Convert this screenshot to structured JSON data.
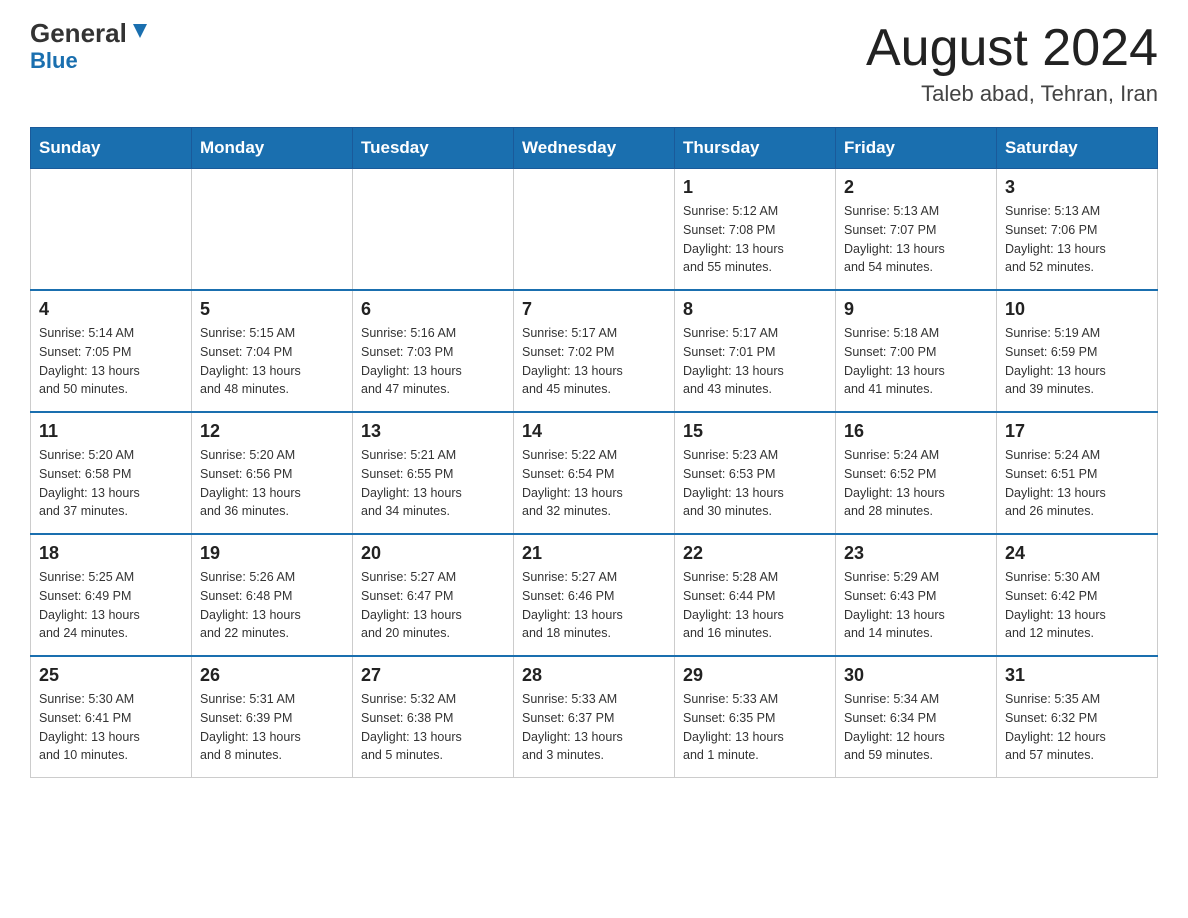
{
  "header": {
    "logo_general": "General",
    "logo_blue": "Blue",
    "title": "August 2024",
    "subtitle": "Taleb abad, Tehran, Iran"
  },
  "days_of_week": [
    "Sunday",
    "Monday",
    "Tuesday",
    "Wednesday",
    "Thursday",
    "Friday",
    "Saturday"
  ],
  "weeks": [
    [
      {
        "day": "",
        "info": ""
      },
      {
        "day": "",
        "info": ""
      },
      {
        "day": "",
        "info": ""
      },
      {
        "day": "",
        "info": ""
      },
      {
        "day": "1",
        "info": "Sunrise: 5:12 AM\nSunset: 7:08 PM\nDaylight: 13 hours\nand 55 minutes."
      },
      {
        "day": "2",
        "info": "Sunrise: 5:13 AM\nSunset: 7:07 PM\nDaylight: 13 hours\nand 54 minutes."
      },
      {
        "day": "3",
        "info": "Sunrise: 5:13 AM\nSunset: 7:06 PM\nDaylight: 13 hours\nand 52 minutes."
      }
    ],
    [
      {
        "day": "4",
        "info": "Sunrise: 5:14 AM\nSunset: 7:05 PM\nDaylight: 13 hours\nand 50 minutes."
      },
      {
        "day": "5",
        "info": "Sunrise: 5:15 AM\nSunset: 7:04 PM\nDaylight: 13 hours\nand 48 minutes."
      },
      {
        "day": "6",
        "info": "Sunrise: 5:16 AM\nSunset: 7:03 PM\nDaylight: 13 hours\nand 47 minutes."
      },
      {
        "day": "7",
        "info": "Sunrise: 5:17 AM\nSunset: 7:02 PM\nDaylight: 13 hours\nand 45 minutes."
      },
      {
        "day": "8",
        "info": "Sunrise: 5:17 AM\nSunset: 7:01 PM\nDaylight: 13 hours\nand 43 minutes."
      },
      {
        "day": "9",
        "info": "Sunrise: 5:18 AM\nSunset: 7:00 PM\nDaylight: 13 hours\nand 41 minutes."
      },
      {
        "day": "10",
        "info": "Sunrise: 5:19 AM\nSunset: 6:59 PM\nDaylight: 13 hours\nand 39 minutes."
      }
    ],
    [
      {
        "day": "11",
        "info": "Sunrise: 5:20 AM\nSunset: 6:58 PM\nDaylight: 13 hours\nand 37 minutes."
      },
      {
        "day": "12",
        "info": "Sunrise: 5:20 AM\nSunset: 6:56 PM\nDaylight: 13 hours\nand 36 minutes."
      },
      {
        "day": "13",
        "info": "Sunrise: 5:21 AM\nSunset: 6:55 PM\nDaylight: 13 hours\nand 34 minutes."
      },
      {
        "day": "14",
        "info": "Sunrise: 5:22 AM\nSunset: 6:54 PM\nDaylight: 13 hours\nand 32 minutes."
      },
      {
        "day": "15",
        "info": "Sunrise: 5:23 AM\nSunset: 6:53 PM\nDaylight: 13 hours\nand 30 minutes."
      },
      {
        "day": "16",
        "info": "Sunrise: 5:24 AM\nSunset: 6:52 PM\nDaylight: 13 hours\nand 28 minutes."
      },
      {
        "day": "17",
        "info": "Sunrise: 5:24 AM\nSunset: 6:51 PM\nDaylight: 13 hours\nand 26 minutes."
      }
    ],
    [
      {
        "day": "18",
        "info": "Sunrise: 5:25 AM\nSunset: 6:49 PM\nDaylight: 13 hours\nand 24 minutes."
      },
      {
        "day": "19",
        "info": "Sunrise: 5:26 AM\nSunset: 6:48 PM\nDaylight: 13 hours\nand 22 minutes."
      },
      {
        "day": "20",
        "info": "Sunrise: 5:27 AM\nSunset: 6:47 PM\nDaylight: 13 hours\nand 20 minutes."
      },
      {
        "day": "21",
        "info": "Sunrise: 5:27 AM\nSunset: 6:46 PM\nDaylight: 13 hours\nand 18 minutes."
      },
      {
        "day": "22",
        "info": "Sunrise: 5:28 AM\nSunset: 6:44 PM\nDaylight: 13 hours\nand 16 minutes."
      },
      {
        "day": "23",
        "info": "Sunrise: 5:29 AM\nSunset: 6:43 PM\nDaylight: 13 hours\nand 14 minutes."
      },
      {
        "day": "24",
        "info": "Sunrise: 5:30 AM\nSunset: 6:42 PM\nDaylight: 13 hours\nand 12 minutes."
      }
    ],
    [
      {
        "day": "25",
        "info": "Sunrise: 5:30 AM\nSunset: 6:41 PM\nDaylight: 13 hours\nand 10 minutes."
      },
      {
        "day": "26",
        "info": "Sunrise: 5:31 AM\nSunset: 6:39 PM\nDaylight: 13 hours\nand 8 minutes."
      },
      {
        "day": "27",
        "info": "Sunrise: 5:32 AM\nSunset: 6:38 PM\nDaylight: 13 hours\nand 5 minutes."
      },
      {
        "day": "28",
        "info": "Sunrise: 5:33 AM\nSunset: 6:37 PM\nDaylight: 13 hours\nand 3 minutes."
      },
      {
        "day": "29",
        "info": "Sunrise: 5:33 AM\nSunset: 6:35 PM\nDaylight: 13 hours\nand 1 minute."
      },
      {
        "day": "30",
        "info": "Sunrise: 5:34 AM\nSunset: 6:34 PM\nDaylight: 12 hours\nand 59 minutes."
      },
      {
        "day": "31",
        "info": "Sunrise: 5:35 AM\nSunset: 6:32 PM\nDaylight: 12 hours\nand 57 minutes."
      }
    ]
  ]
}
